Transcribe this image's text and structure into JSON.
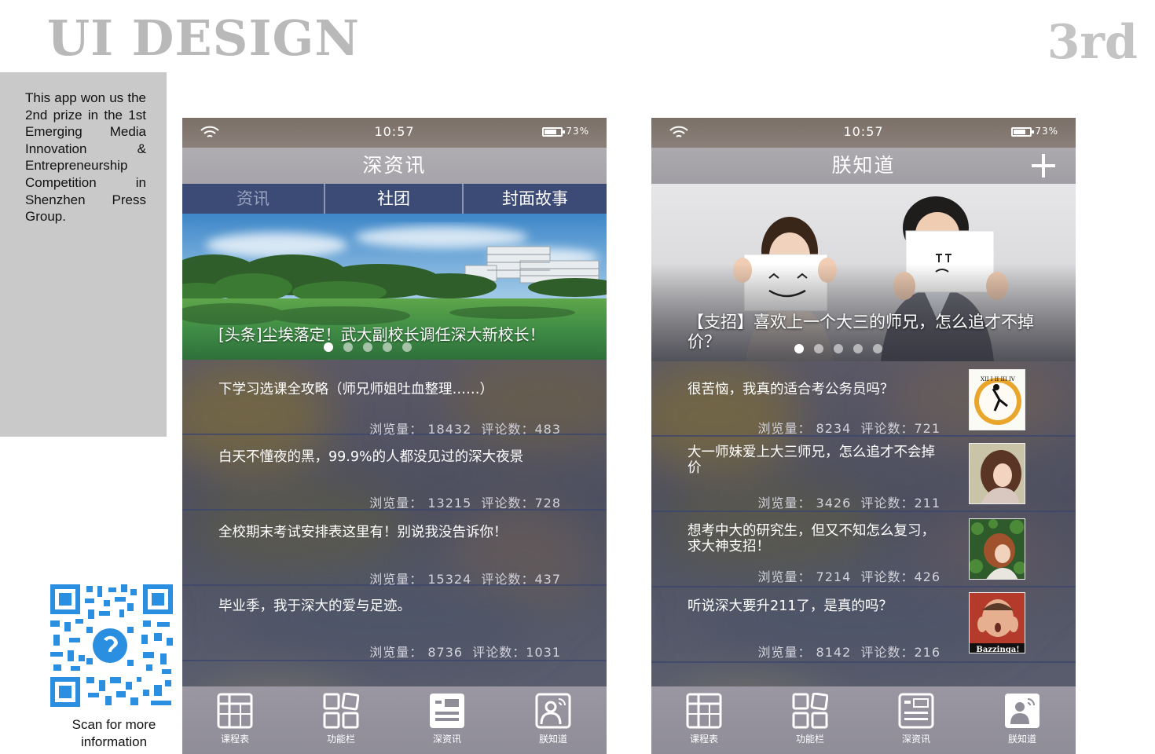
{
  "header": {
    "title": "UI DESIGN",
    "page_label": "3rd"
  },
  "side_note": "This app won us the 2nd prize in the 1st Emerging Media Innovation & Entrepreneurship Competition in Shenzhen Press Group.",
  "qr": {
    "caption_line1": "Scan for more",
    "caption_line2": "information"
  },
  "left_phone": {
    "status": {
      "time": "10:57",
      "battery": "73%",
      "battery_level": 0.73
    },
    "title": "深资讯",
    "tabs": [
      {
        "label": "资讯",
        "active": true
      },
      {
        "label": "社团",
        "active": false
      },
      {
        "label": "封面故事",
        "active": false
      }
    ],
    "banner": {
      "caption": "[头条]尘埃落定！武大副校长调任深大新校长！",
      "dot_count": 5,
      "active_dot": 0
    },
    "articles": [
      {
        "title": "下学习选课全攻略（师兄师姐吐血整理……）",
        "views_label": "浏览量：",
        "views": "18432",
        "comments_label": "评论数：",
        "comments": "483"
      },
      {
        "title": "白天不懂夜的黑，99.9%的人都没见过的深大夜景",
        "views_label": "浏览量：",
        "views": "13215",
        "comments_label": "评论数：",
        "comments": "728"
      },
      {
        "title": "全校期末考试安排表这里有！别说我没告诉你！",
        "views_label": "浏览量：",
        "views": "15324",
        "comments_label": "评论数：",
        "comments": "437"
      },
      {
        "title": "毕业季，我于深大的爱与足迹。",
        "views_label": "浏览量：",
        "views": "8736",
        "comments_label": "评论数：",
        "comments": "1031"
      }
    ],
    "tabbar": [
      {
        "label": "课程表",
        "icon": "timetable-icon"
      },
      {
        "label": "功能栏",
        "icon": "grid-icon"
      },
      {
        "label": "深资讯",
        "icon": "news-icon",
        "active": true
      },
      {
        "label": "朕知道",
        "icon": "profile-icon"
      }
    ]
  },
  "right_phone": {
    "status": {
      "time": "10:57",
      "battery": "73%",
      "battery_level": 0.73
    },
    "title": "朕知道",
    "hero": {
      "caption": "【支招】喜欢上一个大三的师兄，怎么追才不掉价？",
      "dot_count": 5,
      "active_dot": 0
    },
    "questions": [
      {
        "title": "很苦恼，我真的适合考公务员吗？",
        "views_label": "浏览量：",
        "views": "8234",
        "comments_label": "评论数：",
        "comments": "721",
        "thumb": "clock-art"
      },
      {
        "title": "大一师妹爱上大三师兄，怎么追才不会掉价",
        "views_label": "浏览量：",
        "views": "3426",
        "comments_label": "评论数：",
        "comments": "211",
        "thumb": "girl-curly-hair"
      },
      {
        "title": "想考中大的研究生，但又不知怎么复习，求大神支招！",
        "views_label": "浏览量：",
        "views": "7214",
        "comments_label": "评论数：",
        "comments": "426",
        "thumb": "girl-leaves"
      },
      {
        "title": "听说深大要升211了，是真的吗？",
        "views_label": "浏览量：",
        "views": "8142",
        "comments_label": "评论数：",
        "comments": "216",
        "thumb": "bazzinga",
        "thumb_caption": "Bazzinga!"
      }
    ],
    "tabbar": [
      {
        "label": "课程表",
        "icon": "timetable-icon"
      },
      {
        "label": "功能栏",
        "icon": "grid-icon"
      },
      {
        "label": "深资讯",
        "icon": "news-icon"
      },
      {
        "label": "朕知道",
        "icon": "profile-icon",
        "active": true
      }
    ]
  }
}
